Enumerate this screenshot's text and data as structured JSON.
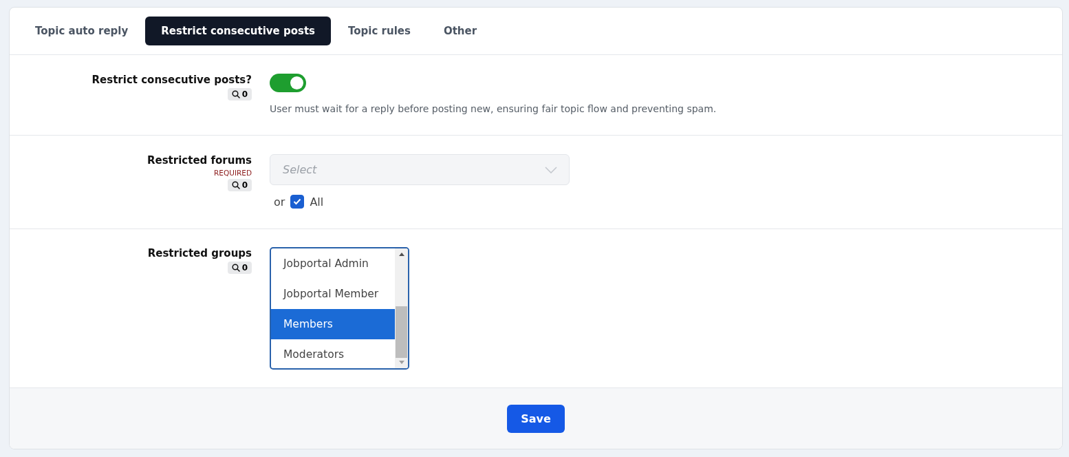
{
  "tabs": [
    {
      "label": "Topic auto reply",
      "selected": false
    },
    {
      "label": "Restrict consecutive posts",
      "selected": true
    },
    {
      "label": "Topic rules",
      "selected": false
    },
    {
      "label": "Other",
      "selected": false
    }
  ],
  "settings": [
    {
      "kind": "toggle",
      "label": "Restrict consecutive posts?",
      "search_count": "0",
      "on": true,
      "help": "User must wait for a reply before posting new, ensuring fair topic flow and preventing spam."
    },
    {
      "kind": "select",
      "label": "Restricted forums",
      "required": "REQUIRED",
      "search_count": "0",
      "placeholder": "Select",
      "or_text": "or",
      "all": {
        "label": "All",
        "checked": true
      }
    },
    {
      "kind": "listbox",
      "label": "Restricted groups",
      "search_count": "0",
      "options": [
        {
          "label": "Jobportal Admin",
          "selected": false
        },
        {
          "label": "Jobportal Member",
          "selected": false
        },
        {
          "label": "Members",
          "selected": true
        },
        {
          "label": "Moderators",
          "selected": false
        }
      ]
    }
  ],
  "save_button": "Save"
}
